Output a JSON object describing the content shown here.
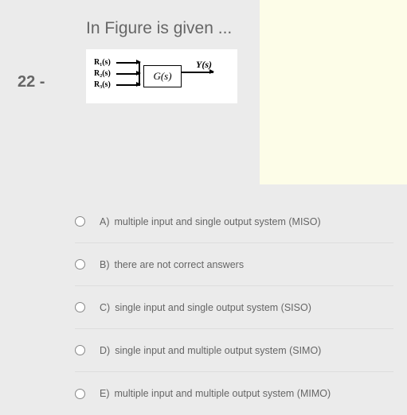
{
  "question": {
    "number": "22 -",
    "text": "In Figure is given ..."
  },
  "diagram": {
    "inputs": [
      "R₁(s)",
      "R₂(s)",
      "R₃(s)"
    ],
    "block": "G(s)",
    "output": "Y(s)"
  },
  "options": [
    {
      "letter": "A)",
      "text": "multiple input and single output system (MISO)"
    },
    {
      "letter": "B)",
      "text": "there are not correct answers"
    },
    {
      "letter": "C)",
      "text": "single input and single output system (SISO)"
    },
    {
      "letter": "D)",
      "text": "single input and multiple output system (SIMO)"
    },
    {
      "letter": "E)",
      "text": "multiple input and multiple output system (MIMO)"
    }
  ]
}
